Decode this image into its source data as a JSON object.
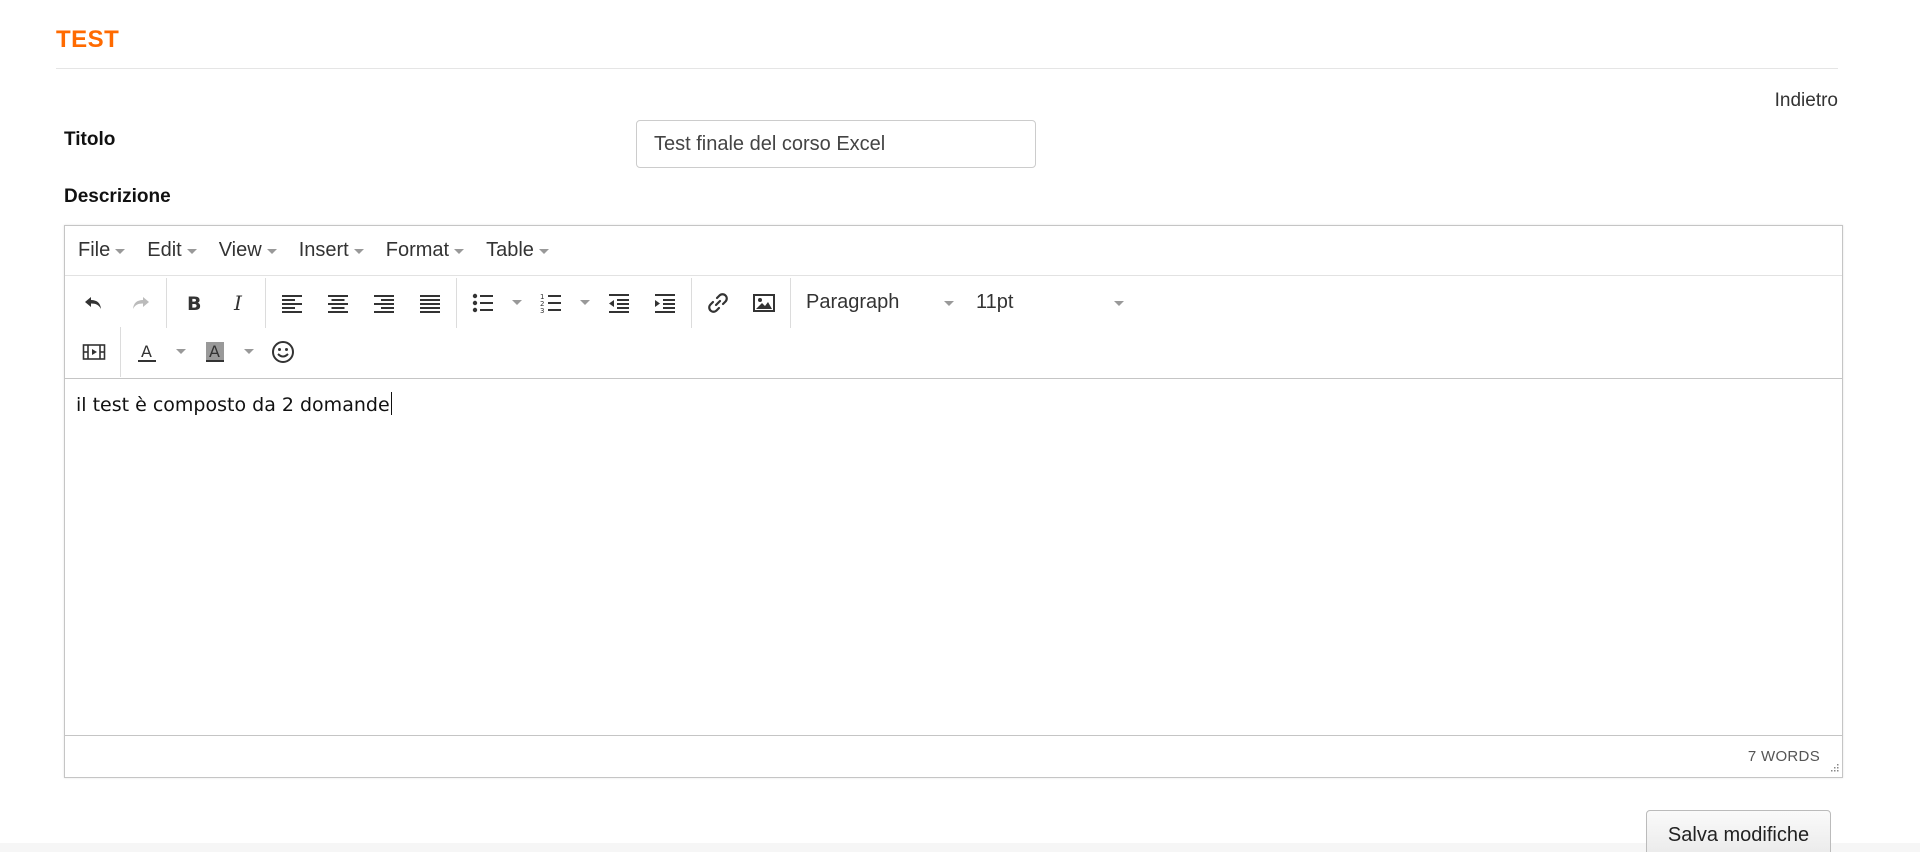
{
  "header": {
    "title": "TEST",
    "back_label": "Indietro"
  },
  "form": {
    "title_label": "Titolo",
    "title_value": "Test finale del corso Excel",
    "description_label": "Descrizione",
    "save_label": "Salva modifiche"
  },
  "editor": {
    "menus": [
      "File",
      "Edit",
      "View",
      "Insert",
      "Format",
      "Table"
    ],
    "block_format": "Paragraph",
    "font_size": "11pt",
    "content": "il test è composto da 2 domande",
    "word_count": "7 WORDS",
    "toolbar_icons": [
      "undo-icon",
      "redo-icon",
      "bold-icon",
      "italic-icon",
      "align-left-icon",
      "align-center-icon",
      "align-right-icon",
      "align-justify-icon",
      "bullet-list-icon",
      "numbered-list-icon",
      "outdent-icon",
      "indent-icon",
      "link-icon",
      "image-icon",
      "media-icon",
      "text-color-icon",
      "background-color-icon",
      "emoticons-icon"
    ]
  },
  "colors": {
    "accent": "#ff6a00"
  }
}
